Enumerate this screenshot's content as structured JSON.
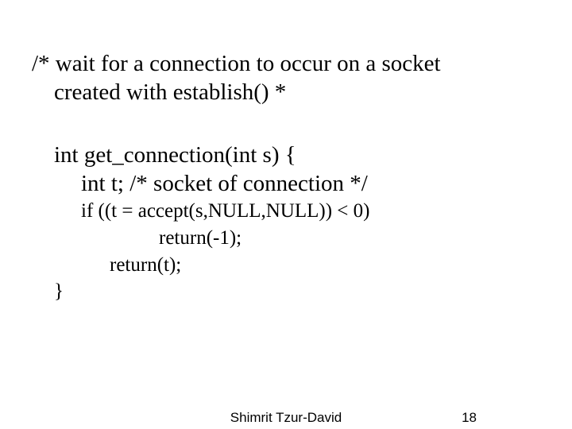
{
  "comment": {
    "line1": "/* wait for a connection to occur on a socket",
    "line2": "created with establish() *"
  },
  "code": {
    "sig": "int get_connection(int s) {",
    "decl": "int t; /* socket of connection */",
    "ifline": "if ((t = accept(s,NULL,NULL)) < 0)",
    "ret1": "return(-1);",
    "ret2": "return(t);",
    "close": "}"
  },
  "footer": {
    "author": "Shimrit Tzur-David",
    "page": "18"
  }
}
